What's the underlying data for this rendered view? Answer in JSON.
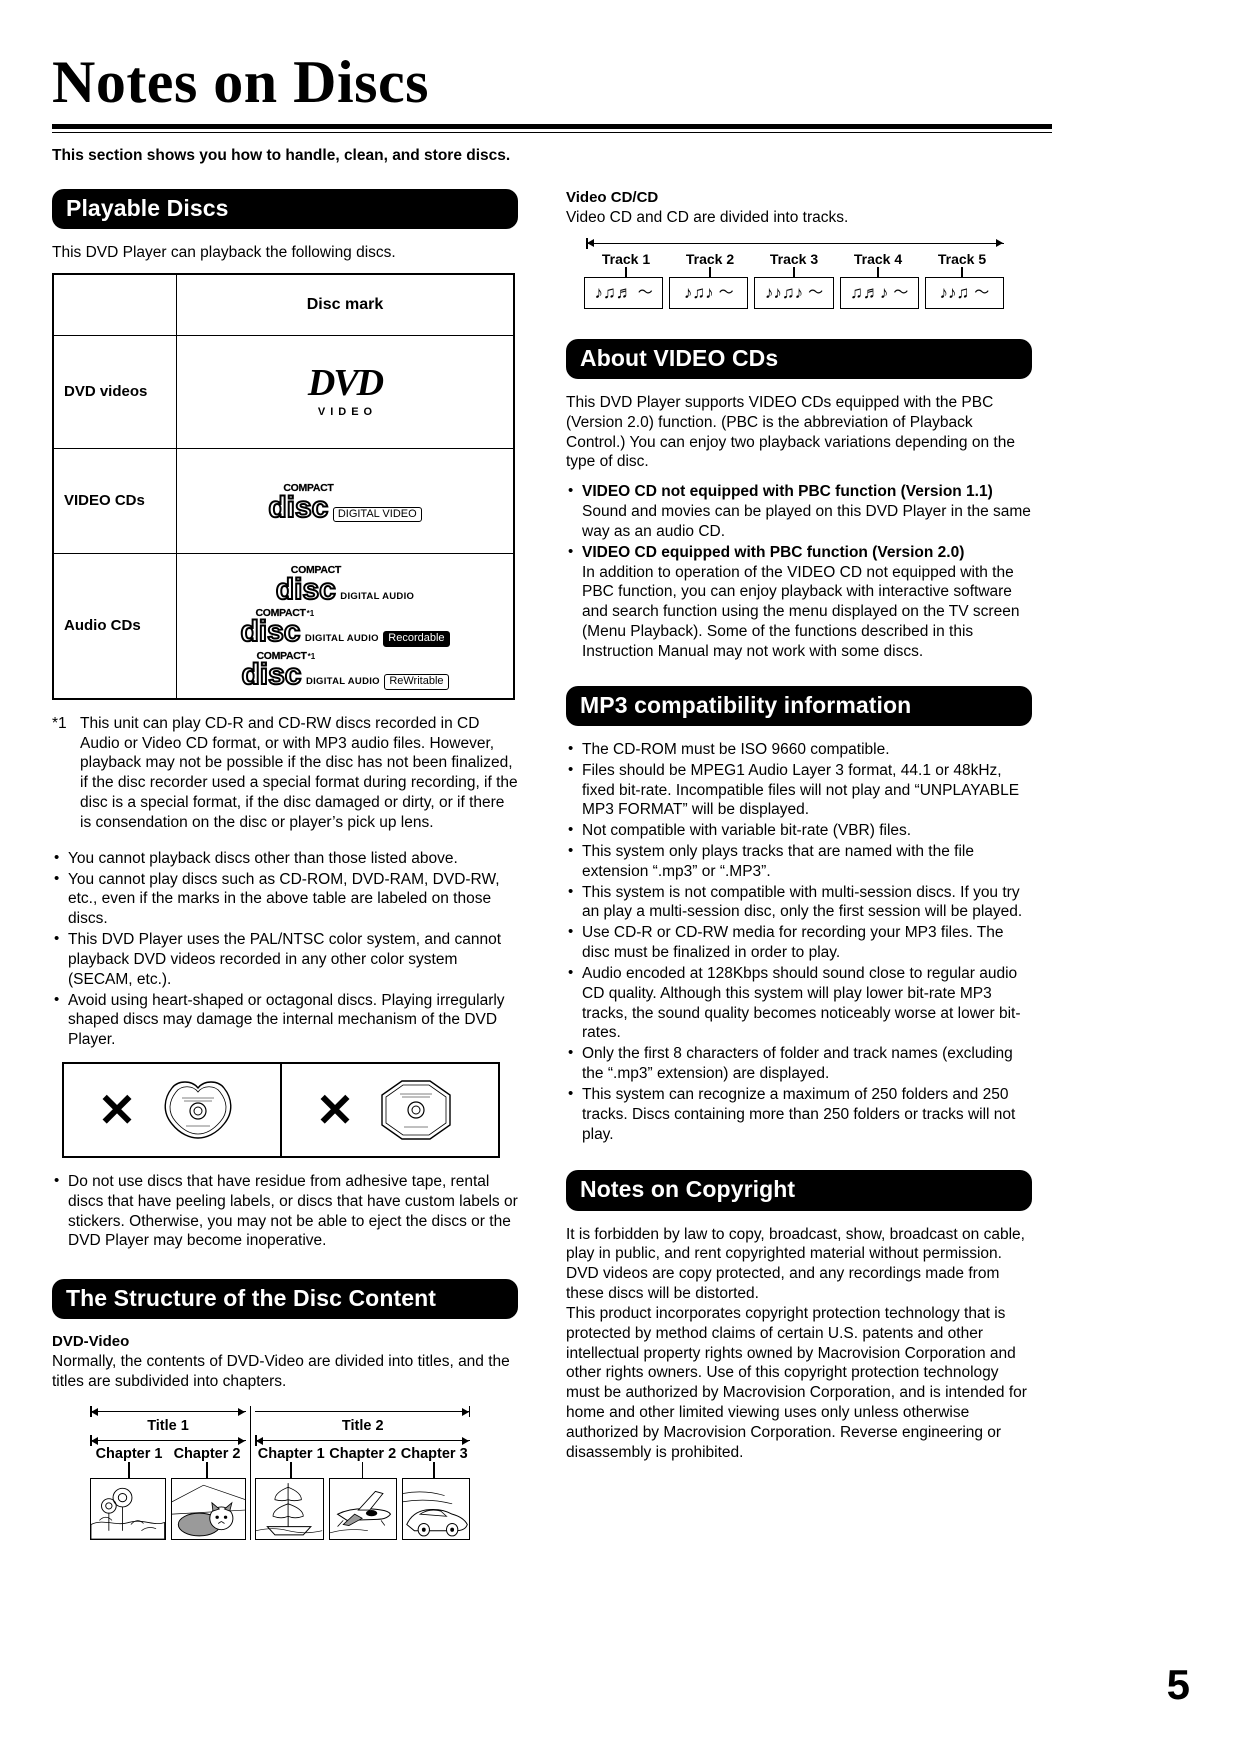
{
  "page": {
    "title": "Notes on Discs",
    "intro": "This section shows you how to handle, clean, and store discs.",
    "number": "5"
  },
  "playable_discs": {
    "heading": "Playable Discs",
    "intro": "This DVD Player can playback the following discs.",
    "table": {
      "col_header": "Disc mark",
      "rows": [
        {
          "label": "DVD videos",
          "marks": [
            {
              "type": "dvd-video",
              "word": "DVD",
              "sub": "VIDEO"
            }
          ]
        },
        {
          "label": "VIDEO CDs",
          "marks": [
            {
              "type": "cd",
              "top": "COMPACT",
              "word": "disc",
              "bottom": "",
              "badge": "DIGITAL VIDEO",
              "badge_inverted": false,
              "star": ""
            }
          ]
        },
        {
          "label": "Audio CDs",
          "marks": [
            {
              "type": "cd",
              "top": "COMPACT",
              "word": "disc",
              "bottom": "DIGITAL AUDIO",
              "badge": "",
              "badge_inverted": false,
              "star": ""
            },
            {
              "type": "cd",
              "top": "COMPACT",
              "word": "disc",
              "bottom": "DIGITAL AUDIO",
              "badge": "Recordable",
              "badge_inverted": true,
              "star": "*1"
            },
            {
              "type": "cd",
              "top": "COMPACT",
              "word": "disc",
              "bottom": "DIGITAL AUDIO",
              "badge": "ReWritable",
              "badge_inverted": false,
              "star": "*1"
            }
          ]
        }
      ]
    },
    "footnote_mark": "*1",
    "footnote": "This unit can play CD-R and CD-RW discs recorded in CD Audio or Video CD format, or with MP3 audio files. However, playback may not be possible if the disc has not been finalized, if the disc recorder used a special format during recording, if the disc is a special format, if the disc damaged or dirty, or if there is consendation on the disc or player’s pick up lens.",
    "bullets": [
      "You cannot playback discs other than those listed above.",
      "You cannot play discs such as CD-ROM, DVD-RAM, DVD-RW, etc., even if the marks in the above table are labeled on those discs.",
      "This DVD Player uses the PAL/NTSC color system, and cannot playback DVD videos recorded in any other color system (SECAM, etc.).",
      "Avoid using heart-shaped or octagonal discs. Playing irregularly shaped discs may damage the internal mechanism of the DVD Player."
    ],
    "shapes_figure": {
      "left": {
        "mark": "✕",
        "shape": "heart-shaped-disc"
      },
      "right": {
        "mark": "✕",
        "shape": "octagonal-disc"
      }
    },
    "bullets_after": [
      "Do not use discs that have residue from adhesive tape, rental discs that have peeling labels, or discs that have custom labels or stickers. Otherwise, you may not be able to eject the discs or the DVD Player may become inoperative."
    ]
  },
  "video_cd_cd": {
    "sub_head": "Video CD/CD",
    "text": "Video CD and CD are divided into tracks.",
    "tracks": [
      {
        "label": "Track 1",
        "notes": "♪♫♬"
      },
      {
        "label": "Track 2",
        "notes": "♪♫♪"
      },
      {
        "label": "Track 3",
        "notes": "♪♪♫♪"
      },
      {
        "label": "Track 4",
        "notes": "♫♬♪"
      },
      {
        "label": "Track 5",
        "notes": "♪♪♫"
      }
    ]
  },
  "about_video_cds": {
    "heading": "About VIDEO CDs",
    "paragraph": "This DVD Player supports VIDEO CDs equipped with the PBC (Version 2.0) function. (PBC is the abbreviation of Playback Control.) You can enjoy two playback variations depending on the type of disc.",
    "bullets": [
      {
        "title": "VIDEO CD not equipped with PBC function  (Version 1.1)",
        "body": "Sound and movies can be played on this DVD Player in the same way as an audio CD."
      },
      {
        "title": "VIDEO CD equipped with PBC function  (Version 2.0)",
        "body": "In addition to operation of the VIDEO CD not equipped with the PBC function, you can enjoy playback with interactive software and search function using the menu displayed on the TV screen (Menu Playback). Some of the functions described in this Instruction Manual may not work with some discs."
      }
    ]
  },
  "mp3": {
    "heading": "MP3 compatibility information",
    "bullets": [
      "The CD-ROM must be ISO 9660 compatible.",
      "Files should be MPEG1 Audio Layer 3 format, 44.1 or 48kHz, fixed bit-rate. Incompatible files will not play and “UNPLAYABLE MP3 FORMAT” will be displayed.",
      "Not compatible with variable bit-rate (VBR) files.",
      "This system only plays tracks that are named with the file extension “.mp3” or “.MP3”.",
      "This system is not compatible with multi-session discs. If you try an play a multi-session disc, only the first session will be played.",
      "Use CD-R or CD-RW media for recording your MP3 files. The disc must be finalized in order to play.",
      "Audio encoded at 128Kbps should sound close to regular audio CD quality. Although this system will play lower bit-rate MP3 tracks,  the sound quality becomes noticeably worse at lower bit-rates.",
      "Only the first 8 characters of folder and track names (excluding the “.mp3” extension) are displayed.",
      "This system can recognize a maximum of 250 folders and 250 tracks. Discs containing more than 250 folders or tracks will not play."
    ]
  },
  "structure": {
    "heading": "The Structure of the Disc Content",
    "sub_head": "DVD-Video",
    "text": "Normally, the contents of DVD-Video are divided into titles, and the titles are subdivided into chapters.",
    "titles": [
      {
        "label": "Title 1",
        "chapters": [
          "Chapter 1",
          "Chapter 2"
        ]
      },
      {
        "label": "Title 2",
        "chapters": [
          "Chapter 1",
          "Chapter 2",
          "Chapter 3"
        ]
      }
    ]
  },
  "copyright": {
    "heading": "Notes on Copyright",
    "paragraphs": [
      "It is forbidden by law to copy, broadcast, show, broadcast on cable, play in public, and rent copyrighted material without permission.",
      "DVD videos are copy protected, and any recordings made from these discs will be distorted.",
      "This product incorporates copyright protection technology that is protected by method claims of certain U.S. patents and other intellectual property rights owned by Macrovision Corporation and other rights owners. Use of this copyright protection technology must be authorized by Macrovision Corporation, and is intended for home and other limited viewing uses only unless otherwise authorized by Macrovision Corporation. Reverse engineering or disassembly is prohibited."
    ]
  }
}
